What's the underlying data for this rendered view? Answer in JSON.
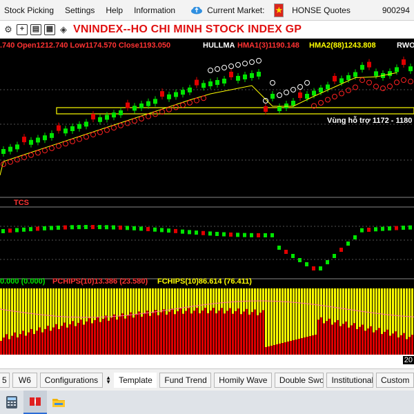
{
  "menu": {
    "items": [
      "Stock Picking",
      "Settings",
      "Help",
      "Information"
    ],
    "market_label": "Current Market:",
    "quotes_label": "HONSE Quotes",
    "account": "900294"
  },
  "title": {
    "text": "VNINDEX--HO CHI MINH STOCK INDEX  GP"
  },
  "chart": {
    "ohlc_text": ".740 Open1212.740 Low1174.570 Close1193.050",
    "hullma_label": "HULLMA",
    "hma1_text": "HMA1(3)1190.148",
    "hma2_text": "HMA2(88)1243.808",
    "rwo_text": "RWO",
    "support_text": "Vùng hỗ trợ 1172 - 1180",
    "tcs_label": "TCS",
    "chips_text_1": "0.000 (0.000)",
    "chips_text_2": "PCHIPS(10)13.386 (23.580)",
    "chips_text_3": "FCHIPS(10)86.614 (76.411)",
    "date_stub": "20",
    "colors": {
      "up": "#00e600",
      "down": "#e00000",
      "yellow": "#ffff00",
      "red": "#e00000"
    }
  },
  "tabs": [
    "5",
    "W6",
    "Configurations",
    "Template",
    "Fund Trend",
    "Homily Wave",
    "Double Swor",
    "Institutional A",
    "Custom"
  ],
  "taskbar": [
    "calculator-app",
    "stock-app",
    "file-explorer"
  ]
}
